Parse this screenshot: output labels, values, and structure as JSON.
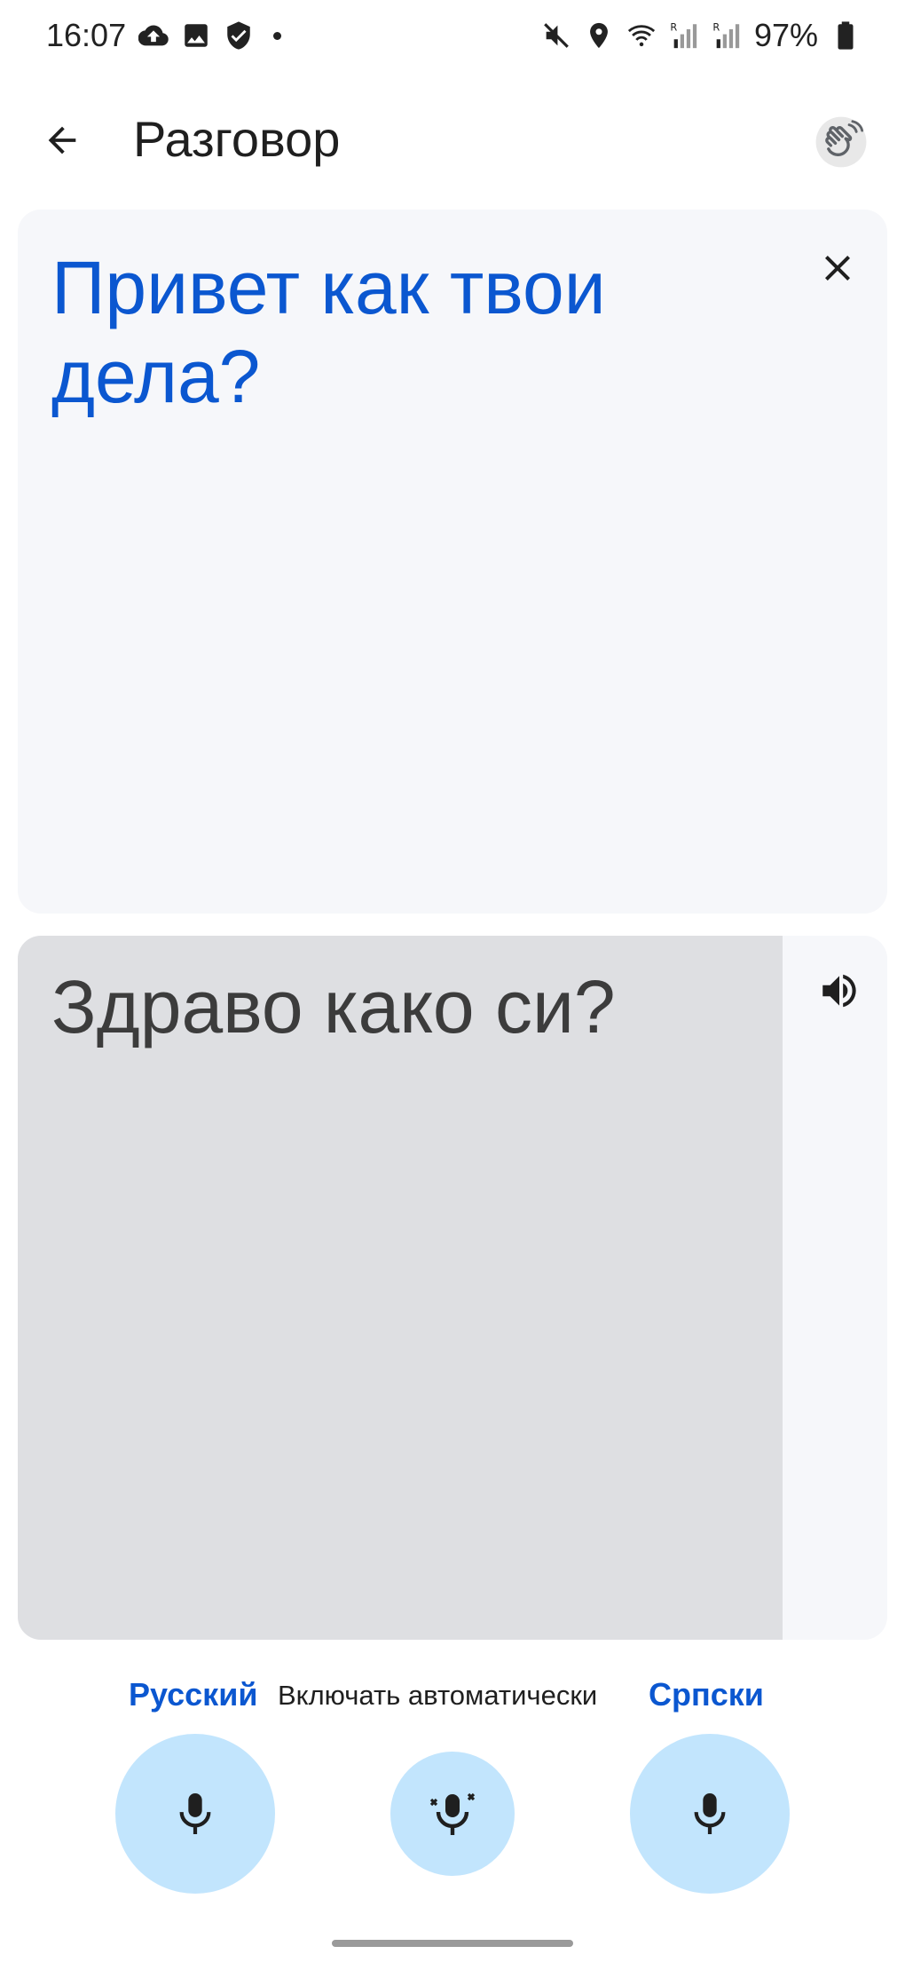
{
  "status_bar": {
    "time": "16:07",
    "battery": "97%",
    "left_icons": [
      "cloud-upload-icon",
      "gallery-icon",
      "shield-check-icon"
    ],
    "right_icons": [
      "mute-icon",
      "location-icon",
      "wifi-icon",
      "signal-r-icon",
      "signal-r-icon",
      "battery-icon"
    ]
  },
  "app_bar": {
    "title": "Разговор",
    "back_icon": "arrow-back-icon",
    "action_icon": "waving-hand-icon"
  },
  "source_card": {
    "text": "Привет как твои дела?",
    "close_icon": "close-icon",
    "text_color": "#0b57d0"
  },
  "target_card": {
    "text": "Здраво како си?",
    "speaker_icon": "volume-icon"
  },
  "languages": {
    "left": "Русский",
    "auto": "Включать автоматически",
    "right": "Српски"
  },
  "mic_buttons": {
    "left_icon": "mic-icon",
    "auto_icon": "mic-auto-icon",
    "right_icon": "mic-icon",
    "color": "#c2e5fd"
  }
}
